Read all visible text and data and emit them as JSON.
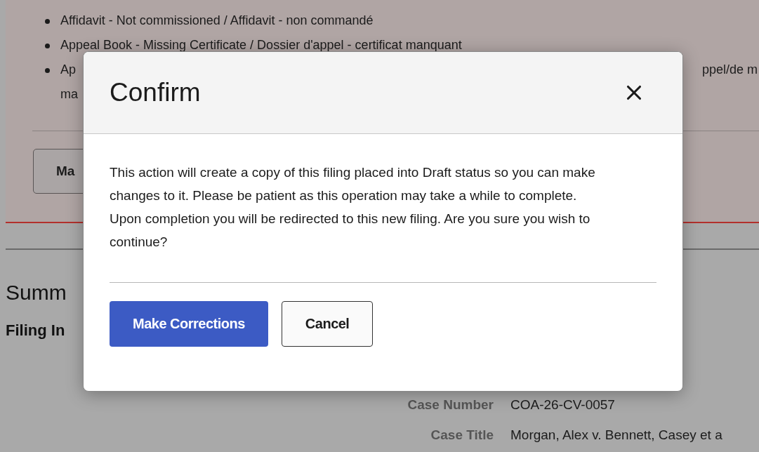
{
  "page": {
    "bullets": [
      {
        "text": "Affidavit - Not commissioned / Affidavit - non commandé"
      },
      {
        "text": "Appeal Book - Missing Certificate / Dossier d'appel - certificat manquant"
      },
      {
        "text": "Ap",
        "text_right": "ppel/de m",
        "continuation": "ma"
      }
    ],
    "action_button": "Ma",
    "summary_heading": "Summ",
    "section_heading": "Filing In",
    "fields": [
      {
        "label": "Case Number",
        "value": "COA-26-CV-0057"
      },
      {
        "label": "Case Title",
        "value": "Morgan, Alex v. Bennett, Casey et a"
      }
    ]
  },
  "dialog": {
    "title": "Confirm",
    "message": "This action will create a copy of this filing placed into Draft status so you can make changes to it. Please be patient as this operation may take a while to complete. Upon completion you will be redirected to this new filing. Are you sure you wish to continue?",
    "buttons": [
      {
        "label": "Make Corrections",
        "kind": "primary"
      },
      {
        "label": "Cancel",
        "kind": "secondary"
      }
    ]
  }
}
